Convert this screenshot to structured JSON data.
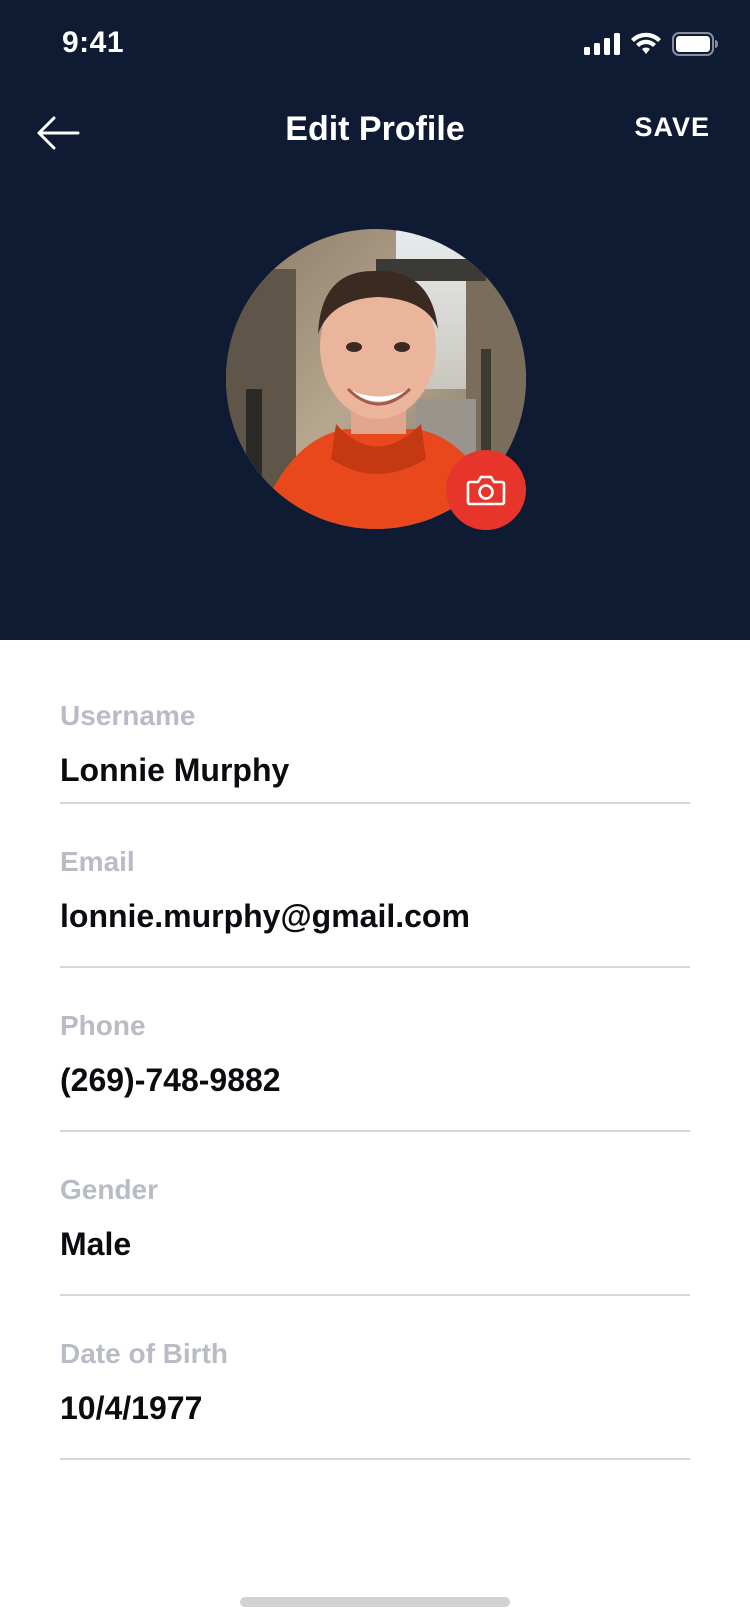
{
  "status_bar": {
    "time": "9:41"
  },
  "nav": {
    "title": "Edit Profile",
    "save_label": "SAVE"
  },
  "form": {
    "fields": [
      {
        "label": "Username",
        "value": "Lonnie Murphy"
      },
      {
        "label": "Email",
        "value": "lonnie.murphy@gmail.com"
      },
      {
        "label": "Phone",
        "value": "(269)-748-9882"
      },
      {
        "label": "Gender",
        "value": "Male"
      },
      {
        "label": "Date of Birth",
        "value": "10/4/1977"
      }
    ]
  },
  "colors": {
    "header_bg": "#0f1a33",
    "accent": "#e8352b",
    "label": "#b9bcc6",
    "value": "#0b0c10",
    "divider": "#d6d7db"
  },
  "icons": [
    "back-arrow-icon",
    "camera-icon",
    "cellular-signal-icon",
    "wifi-icon",
    "battery-icon"
  ]
}
